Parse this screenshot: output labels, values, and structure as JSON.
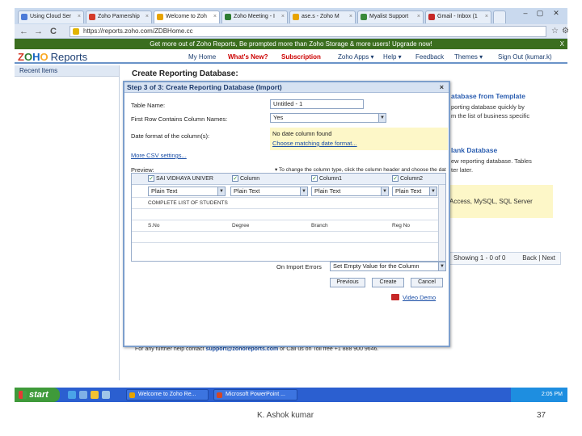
{
  "browser": {
    "tabs": [
      {
        "label": "Using Cloud Ser",
        "color": "#4d7bd8"
      },
      {
        "label": "Zoho Parnership",
        "color": "#d43b2a"
      },
      {
        "label": "Welcome to Zoh",
        "color": "#e8a400"
      },
      {
        "label": "Zoho Meeting - I",
        "color": "#2e7d32"
      },
      {
        "label": "ase.s - Zoho M",
        "color": "#e8a400"
      },
      {
        "label": "Myalist Support",
        "color": "#3a8a3a"
      },
      {
        "label": "Gmail - Inbox (1",
        "color": "#c62828"
      }
    ],
    "tab_close": "×",
    "window_controls": [
      "–",
      "▢",
      "✕"
    ],
    "nav": {
      "back": "←",
      "forward": "→",
      "reload": "C"
    },
    "url": "https://reports.zoho.com/ZDBHome.cc"
  },
  "banner": {
    "text": "Get more out of Zoho Reports, Be prompted more than Zoho Storage & more users! Upgrade now!",
    "close": "X"
  },
  "app": {
    "logo_parts": [
      "Z",
      "O",
      "H",
      "O"
    ],
    "product": "Reports",
    "menu": [
      "My Home",
      "What's New?",
      "Subscription",
      "Zoho Apps ▾",
      "Help ▾",
      "Feedback",
      "Themes ▾",
      "Sign Out (kumar.k)"
    ]
  },
  "sidebar": {
    "heading": "Recent Items"
  },
  "page": {
    "title": "Create Reporting Database:",
    "template_heading": "atabase from Template",
    "template_lines": [
      "porting database quickly by",
      "m the list of business specific"
    ],
    "blank_heading": "lank Database",
    "blank_lines": [
      "ew reporting database. Tables",
      "ter later."
    ],
    "db_text": "Access, MySQL, SQL Server",
    "pager_text": "Showing 1 - 0 of 0",
    "pager_nav": "Back | Next",
    "footer_text": "For any further help contact ",
    "footer_link": "support@zohoreports.com",
    "footer_tail": " or Call us on Toll free +1 888 900 9646."
  },
  "dialog": {
    "title": "Step 3 of 3: Create Reporting Database (Import)",
    "close": "×",
    "table_name_label": "Table Name:",
    "table_name_value": "Untitled - 1",
    "first_row_label": "First Row Contains Column Names:",
    "first_row_value": "Yes",
    "date_format_label": "Date format of the column(s):",
    "date_format_value": "No date column found",
    "date_format_link": "Choose matching date format...",
    "more_settings": "More CSV settings...",
    "preview_label": "Preview:",
    "preview_hint": "▾ To change the column type, click the column header and choose the data type",
    "columns": [
      {
        "name": "SAI VIDHAYA UNIVER",
        "type": "Plain Text"
      },
      {
        "name": "Column",
        "type": "Plain Text"
      },
      {
        "name": "Column1",
        "type": "Plain Text"
      },
      {
        "name": "Column2",
        "type": "Plain Text"
      }
    ],
    "rows": [
      [
        "COMPLETE LIST OF STUDENTS",
        "",
        "",
        ""
      ],
      [
        "",
        "",
        "",
        ""
      ],
      [
        "S.No",
        "Degree",
        "Branch",
        "Reg No"
      ],
      [
        "",
        "",
        "",
        ""
      ]
    ],
    "import_errors_label": "On Import Errors",
    "import_errors_value": "Set Empty Value for the Column",
    "buttons": [
      "Previous",
      "Create",
      "Cancel"
    ],
    "video_demo": "Video Demo"
  },
  "taskbar": {
    "start": "start",
    "items": [
      {
        "label": "Welcome to Zoho Re...",
        "color": "#e8a400"
      },
      {
        "label": "Microsoft PowerPoint ...",
        "color": "#d24726"
      }
    ],
    "time": "2:05 PM"
  },
  "slide": {
    "author": "K. Ashok kumar",
    "page": "37"
  }
}
